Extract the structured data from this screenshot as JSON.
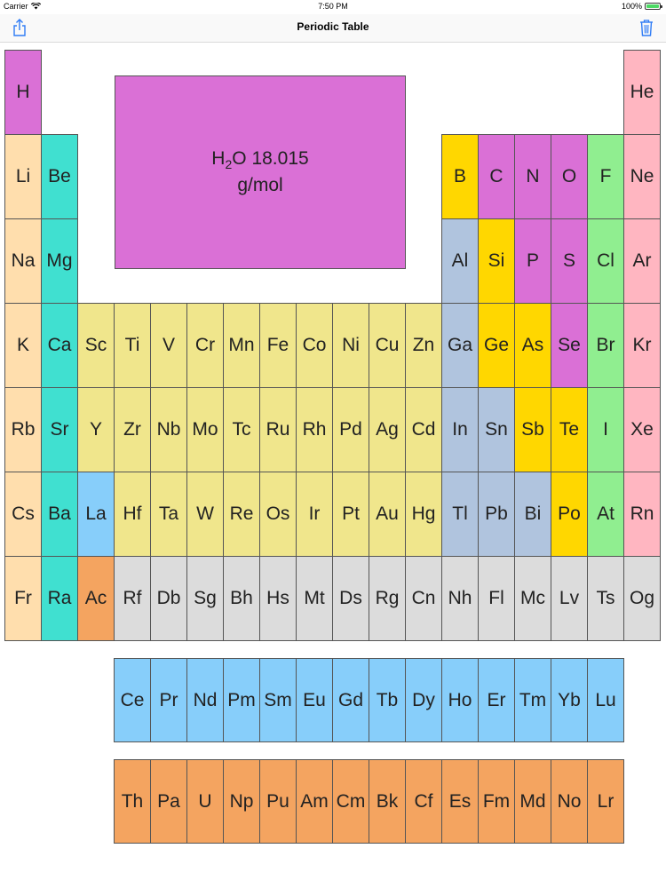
{
  "status_bar": {
    "carrier": "Carrier",
    "time": "7:50 PM",
    "battery": "100%"
  },
  "nav": {
    "title": "Periodic Table"
  },
  "result": {
    "formula_prefix": "H",
    "formula_sub": "2",
    "formula_suffix": "O",
    "mass": "18.015",
    "unit": "g/mol"
  },
  "colors": {
    "alkali": "#ffdead",
    "alkaline": "#40e0d0",
    "nonmetal": "#da70d6",
    "noble": "#ffb6c1",
    "metalloid": "#ffd700",
    "halogen": "#90ee90",
    "post_transition": "#b0c4de",
    "transition": "#f0e68c",
    "lanthanide": "#87cefa",
    "actinide": "#f4a460",
    "unknown": "#dcdcdc"
  },
  "main_rows": [
    [
      [
        "H",
        "nonmetal",
        0
      ],
      [
        "He",
        "noble",
        17
      ]
    ],
    [
      [
        "Li",
        "alkali",
        0
      ],
      [
        "Be",
        "alkaline",
        1
      ],
      [
        "B",
        "metalloid",
        12
      ],
      [
        "C",
        "nonmetal",
        13
      ],
      [
        "N",
        "nonmetal",
        14
      ],
      [
        "O",
        "nonmetal",
        15
      ],
      [
        "F",
        "halogen",
        16
      ],
      [
        "Ne",
        "noble",
        17
      ]
    ],
    [
      [
        "Na",
        "alkali",
        0
      ],
      [
        "Mg",
        "alkaline",
        1
      ],
      [
        "Al",
        "post_transition",
        12
      ],
      [
        "Si",
        "metalloid",
        13
      ],
      [
        "P",
        "nonmetal",
        14
      ],
      [
        "S",
        "nonmetal",
        15
      ],
      [
        "Cl",
        "halogen",
        16
      ],
      [
        "Ar",
        "noble",
        17
      ]
    ],
    [
      [
        "K",
        "alkali",
        0
      ],
      [
        "Ca",
        "alkaline",
        1
      ],
      [
        "Sc",
        "transition",
        2
      ],
      [
        "Ti",
        "transition",
        3
      ],
      [
        "V",
        "transition",
        4
      ],
      [
        "Cr",
        "transition",
        5
      ],
      [
        "Mn",
        "transition",
        6
      ],
      [
        "Fe",
        "transition",
        7
      ],
      [
        "Co",
        "transition",
        8
      ],
      [
        "Ni",
        "transition",
        9
      ],
      [
        "Cu",
        "transition",
        10
      ],
      [
        "Zn",
        "transition",
        11
      ],
      [
        "Ga",
        "post_transition",
        12
      ],
      [
        "Ge",
        "metalloid",
        13
      ],
      [
        "As",
        "metalloid",
        14
      ],
      [
        "Se",
        "nonmetal",
        15
      ],
      [
        "Br",
        "halogen",
        16
      ],
      [
        "Kr",
        "noble",
        17
      ]
    ],
    [
      [
        "Rb",
        "alkali",
        0
      ],
      [
        "Sr",
        "alkaline",
        1
      ],
      [
        "Y",
        "transition",
        2
      ],
      [
        "Zr",
        "transition",
        3
      ],
      [
        "Nb",
        "transition",
        4
      ],
      [
        "Mo",
        "transition",
        5
      ],
      [
        "Tc",
        "transition",
        6
      ],
      [
        "Ru",
        "transition",
        7
      ],
      [
        "Rh",
        "transition",
        8
      ],
      [
        "Pd",
        "transition",
        9
      ],
      [
        "Ag",
        "transition",
        10
      ],
      [
        "Cd",
        "transition",
        11
      ],
      [
        "In",
        "post_transition",
        12
      ],
      [
        "Sn",
        "post_transition",
        13
      ],
      [
        "Sb",
        "metalloid",
        14
      ],
      [
        "Te",
        "metalloid",
        15
      ],
      [
        "I",
        "halogen",
        16
      ],
      [
        "Xe",
        "noble",
        17
      ]
    ],
    [
      [
        "Cs",
        "alkali",
        0
      ],
      [
        "Ba",
        "alkaline",
        1
      ],
      [
        "La",
        "lanthanide",
        2
      ],
      [
        "Hf",
        "transition",
        3
      ],
      [
        "Ta",
        "transition",
        4
      ],
      [
        "W",
        "transition",
        5
      ],
      [
        "Re",
        "transition",
        6
      ],
      [
        "Os",
        "transition",
        7
      ],
      [
        "Ir",
        "transition",
        8
      ],
      [
        "Pt",
        "transition",
        9
      ],
      [
        "Au",
        "transition",
        10
      ],
      [
        "Hg",
        "transition",
        11
      ],
      [
        "Tl",
        "post_transition",
        12
      ],
      [
        "Pb",
        "post_transition",
        13
      ],
      [
        "Bi",
        "post_transition",
        14
      ],
      [
        "Po",
        "metalloid",
        15
      ],
      [
        "At",
        "halogen",
        16
      ],
      [
        "Rn",
        "noble",
        17
      ]
    ],
    [
      [
        "Fr",
        "alkali",
        0
      ],
      [
        "Ra",
        "alkaline",
        1
      ],
      [
        "Ac",
        "actinide",
        2
      ],
      [
        "Rf",
        "unknown",
        3
      ],
      [
        "Db",
        "unknown",
        4
      ],
      [
        "Sg",
        "unknown",
        5
      ],
      [
        "Bh",
        "unknown",
        6
      ],
      [
        "Hs",
        "unknown",
        7
      ],
      [
        "Mt",
        "unknown",
        8
      ],
      [
        "Ds",
        "unknown",
        9
      ],
      [
        "Rg",
        "unknown",
        10
      ],
      [
        "Cn",
        "unknown",
        11
      ],
      [
        "Nh",
        "unknown",
        12
      ],
      [
        "Fl",
        "unknown",
        13
      ],
      [
        "Mc",
        "unknown",
        14
      ],
      [
        "Lv",
        "unknown",
        15
      ],
      [
        "Ts",
        "unknown",
        16
      ],
      [
        "Og",
        "unknown",
        17
      ]
    ]
  ],
  "lanthanides": [
    "Ce",
    "Pr",
    "Nd",
    "Pm",
    "Sm",
    "Eu",
    "Gd",
    "Tb",
    "Dy",
    "Ho",
    "Er",
    "Tm",
    "Yb",
    "Lu"
  ],
  "actinides": [
    "Th",
    "Pa",
    "U",
    "Np",
    "Pu",
    "Am",
    "Cm",
    "Bk",
    "Cf",
    "Es",
    "Fm",
    "Md",
    "No",
    "Lr"
  ]
}
